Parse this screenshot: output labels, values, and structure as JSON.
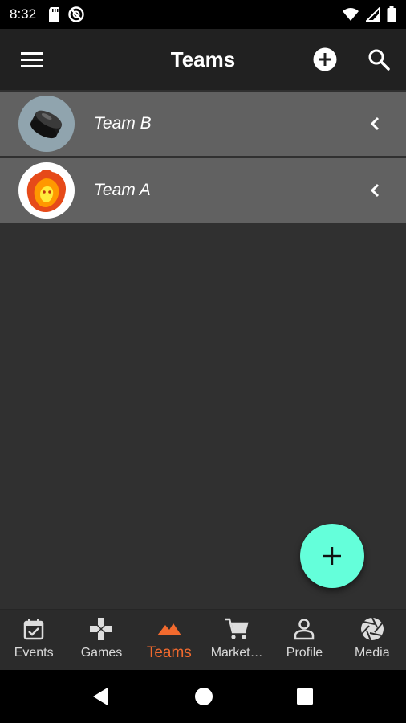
{
  "status_bar": {
    "time": "8:32",
    "left_icons": [
      "sd-card-icon",
      "do-not-disturb-icon"
    ],
    "right_icons": [
      "wifi-icon",
      "signal-icon",
      "battery-icon"
    ]
  },
  "app_bar": {
    "title": "Teams",
    "menu_icon": "menu-icon",
    "add_icon": "add-circle-icon",
    "search_icon": "search-icon"
  },
  "teams": [
    {
      "name": "Team B",
      "avatar_icon": "hockey-puck-icon",
      "action_icon": "chevron-left-icon"
    },
    {
      "name": "Team A",
      "avatar_icon": "fire-lion-logo-icon",
      "action_icon": "chevron-left-icon"
    }
  ],
  "fab": {
    "icon": "plus-icon"
  },
  "bottom_nav": {
    "active": "Teams",
    "items": [
      {
        "label": "Events",
        "icon": "calendar-check-icon"
      },
      {
        "label": "Games",
        "icon": "gamepad-icon"
      },
      {
        "label": "Teams",
        "icon": "mountain-icon"
      },
      {
        "label": "Market…",
        "icon": "cart-icon"
      },
      {
        "label": "Profile",
        "icon": "person-icon"
      },
      {
        "label": "Media",
        "icon": "aperture-icon"
      }
    ]
  },
  "system_nav": {
    "back_icon": "back-triangle-icon",
    "home_icon": "home-circle-icon",
    "recents_icon": "recents-square-icon"
  },
  "colors": {
    "background": "#303030",
    "app_bar": "#212121",
    "row": "#616161",
    "accent": "#F26A2E",
    "fab": "#64FFDA"
  }
}
